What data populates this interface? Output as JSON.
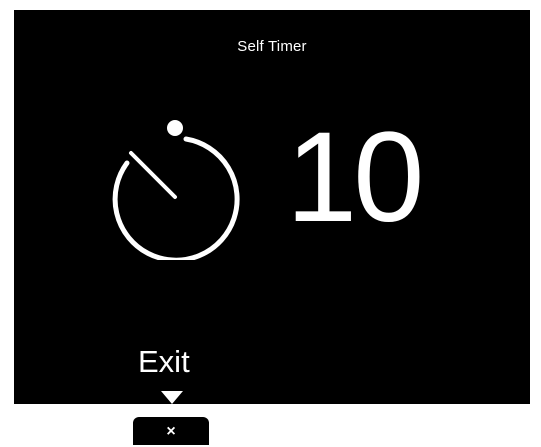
{
  "screen": {
    "title": "Self Timer",
    "countdown": "10",
    "exit_label": "Exit"
  },
  "controls": {
    "exit_button_glyph": "×",
    "timer_icon": "stopwatch-icon",
    "pointer_icon": "triangle-down-icon",
    "close_icon": "close-icon"
  },
  "colors": {
    "screen_background": "#000000",
    "foreground": "#ffffff",
    "page_background": "#ffffff"
  }
}
